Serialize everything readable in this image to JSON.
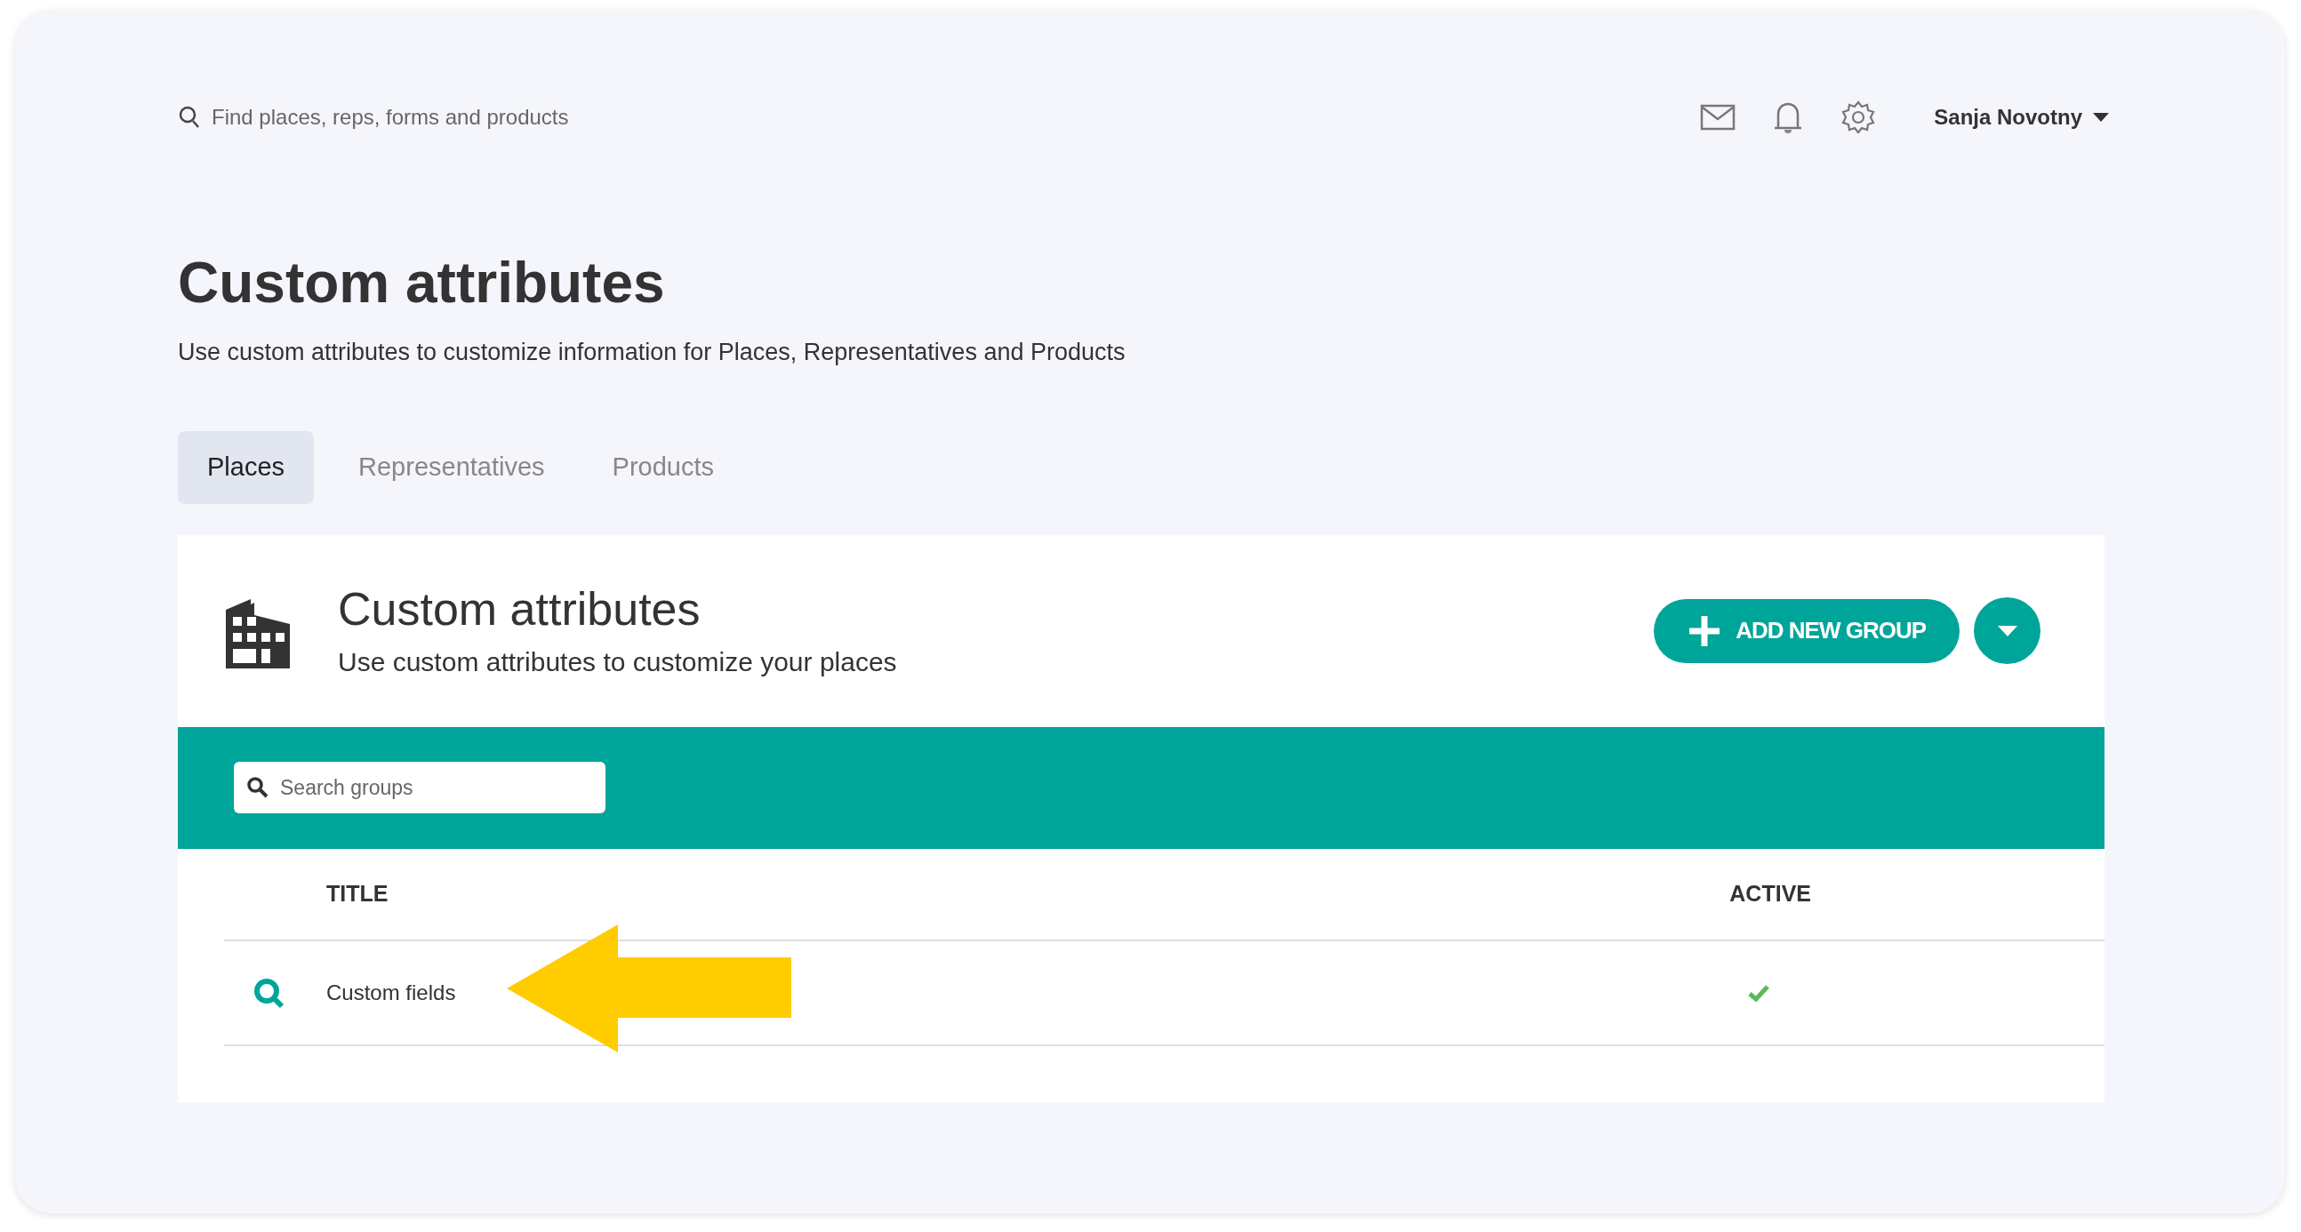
{
  "topbar": {
    "search": {
      "placeholder": "Find places, reps, forms and products"
    },
    "user": {
      "name": "Sanja Novotny"
    }
  },
  "page": {
    "title": "Custom attributes",
    "subtitle": "Use custom attributes to customize information for Places, Representatives and Products"
  },
  "tabs": [
    {
      "label": "Places",
      "selected": true
    },
    {
      "label": "Representatives",
      "selected": false
    },
    {
      "label": "Products",
      "selected": false
    }
  ],
  "card": {
    "title": "Custom attributes",
    "subtitle": "Use custom attributes to customize your places",
    "add_button": "ADD NEW GROUP"
  },
  "groups_search": {
    "placeholder": "Search groups"
  },
  "table": {
    "columns": [
      "TITLE",
      "ACTIVE"
    ],
    "rows": [
      {
        "title": "Custom fields",
        "active": true
      }
    ]
  }
}
